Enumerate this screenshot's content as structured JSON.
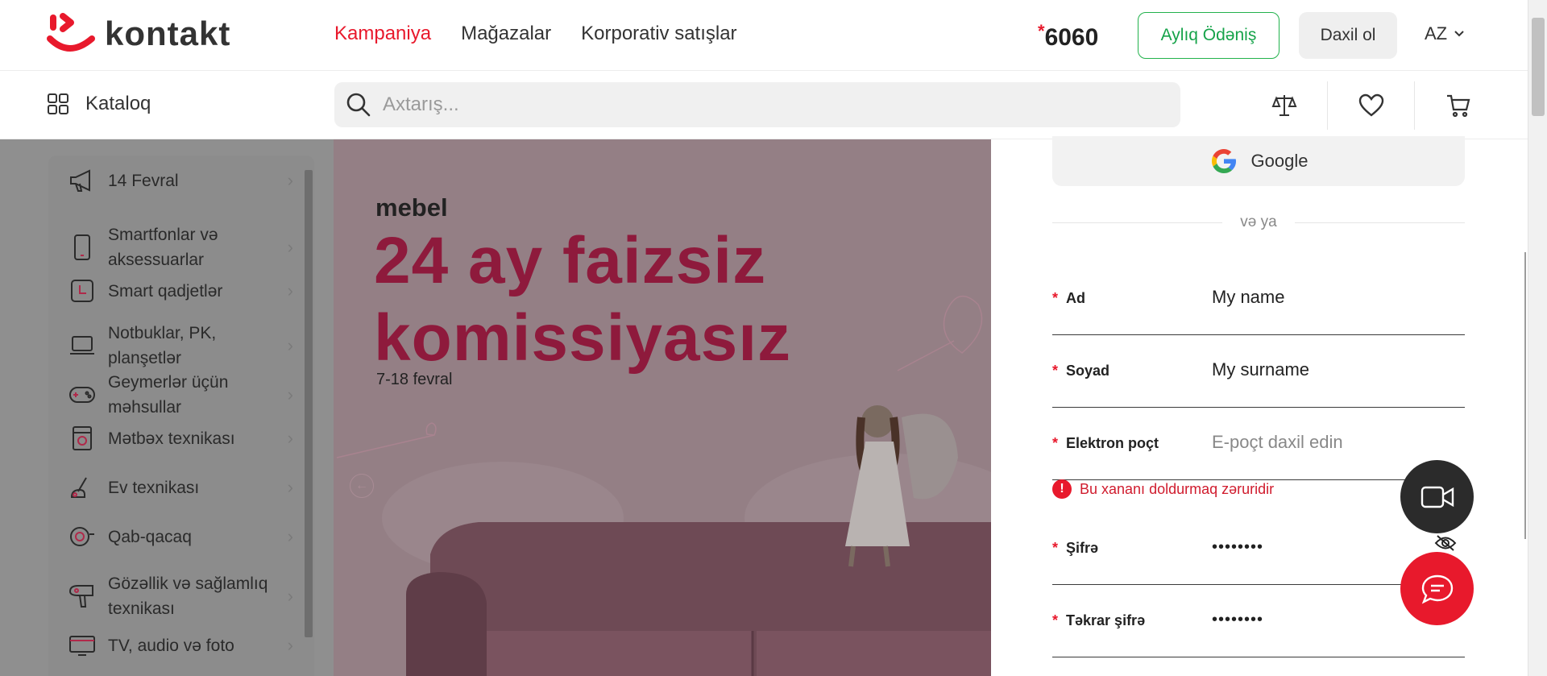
{
  "header": {
    "logo_text": "kontakt",
    "nav": [
      {
        "label": "Kampaniya",
        "active": true
      },
      {
        "label": "Mağazalar",
        "active": false
      },
      {
        "label": "Korporativ satışlar",
        "active": false
      }
    ],
    "phone_star": "*",
    "phone": "6060",
    "monthly_payment": "Aylıq Ödəniş",
    "login": "Daxil ol",
    "language": "AZ"
  },
  "subheader": {
    "catalog": "Kataloq",
    "search_placeholder": "Axtarış...",
    "icons": [
      "compare-icon",
      "heart-icon",
      "cart-icon"
    ]
  },
  "sidebar": {
    "items": [
      {
        "label": "14 Fevral",
        "icon": "megaphone-icon"
      },
      {
        "label": "Smartfonlar və aksessuarlar",
        "icon": "smartphone-icon"
      },
      {
        "label": "Smart qadjetlər",
        "icon": "smartwatch-icon"
      },
      {
        "label": "Notbuklar, PK, planşetlər",
        "icon": "laptop-icon"
      },
      {
        "label": "Geymerlər üçün məhsullar",
        "icon": "gamepad-icon"
      },
      {
        "label": "Mətbəx texnikası",
        "icon": "kitchen-icon"
      },
      {
        "label": "Ev texnikası",
        "icon": "vacuum-icon"
      },
      {
        "label": "Qab-qacaq",
        "icon": "cookware-icon"
      },
      {
        "label": "Gözəllik və sağlamlıq texnikası",
        "icon": "hairdryer-icon"
      },
      {
        "label": "TV, audio və foto",
        "icon": "tv-icon"
      }
    ]
  },
  "banner": {
    "subtitle": "mebel",
    "title_line1": "24 ay faizsiz",
    "title_line2": "komissiyasız",
    "dates": "7-18 fevral"
  },
  "form": {
    "google": "Google",
    "or": "və ya",
    "fields": [
      {
        "label": "Ad",
        "value": "My name",
        "placeholder": ""
      },
      {
        "label": "Soyad",
        "value": "My surname",
        "placeholder": ""
      },
      {
        "label": "Elektron poçt",
        "value": "",
        "placeholder": "E-poçt daxil edin"
      },
      {
        "label": "Şifrə",
        "value": "••••••••"
      },
      {
        "label": "Təkrar şifrə",
        "value": "••••••••"
      }
    ],
    "required_mark": "*",
    "error": "Bu xananı doldurmaq zəruridir",
    "error_mark": "!"
  },
  "colors": {
    "brand_red": "#e8192c",
    "green": "#22b24c",
    "banner_title": "#8e1a3c"
  }
}
